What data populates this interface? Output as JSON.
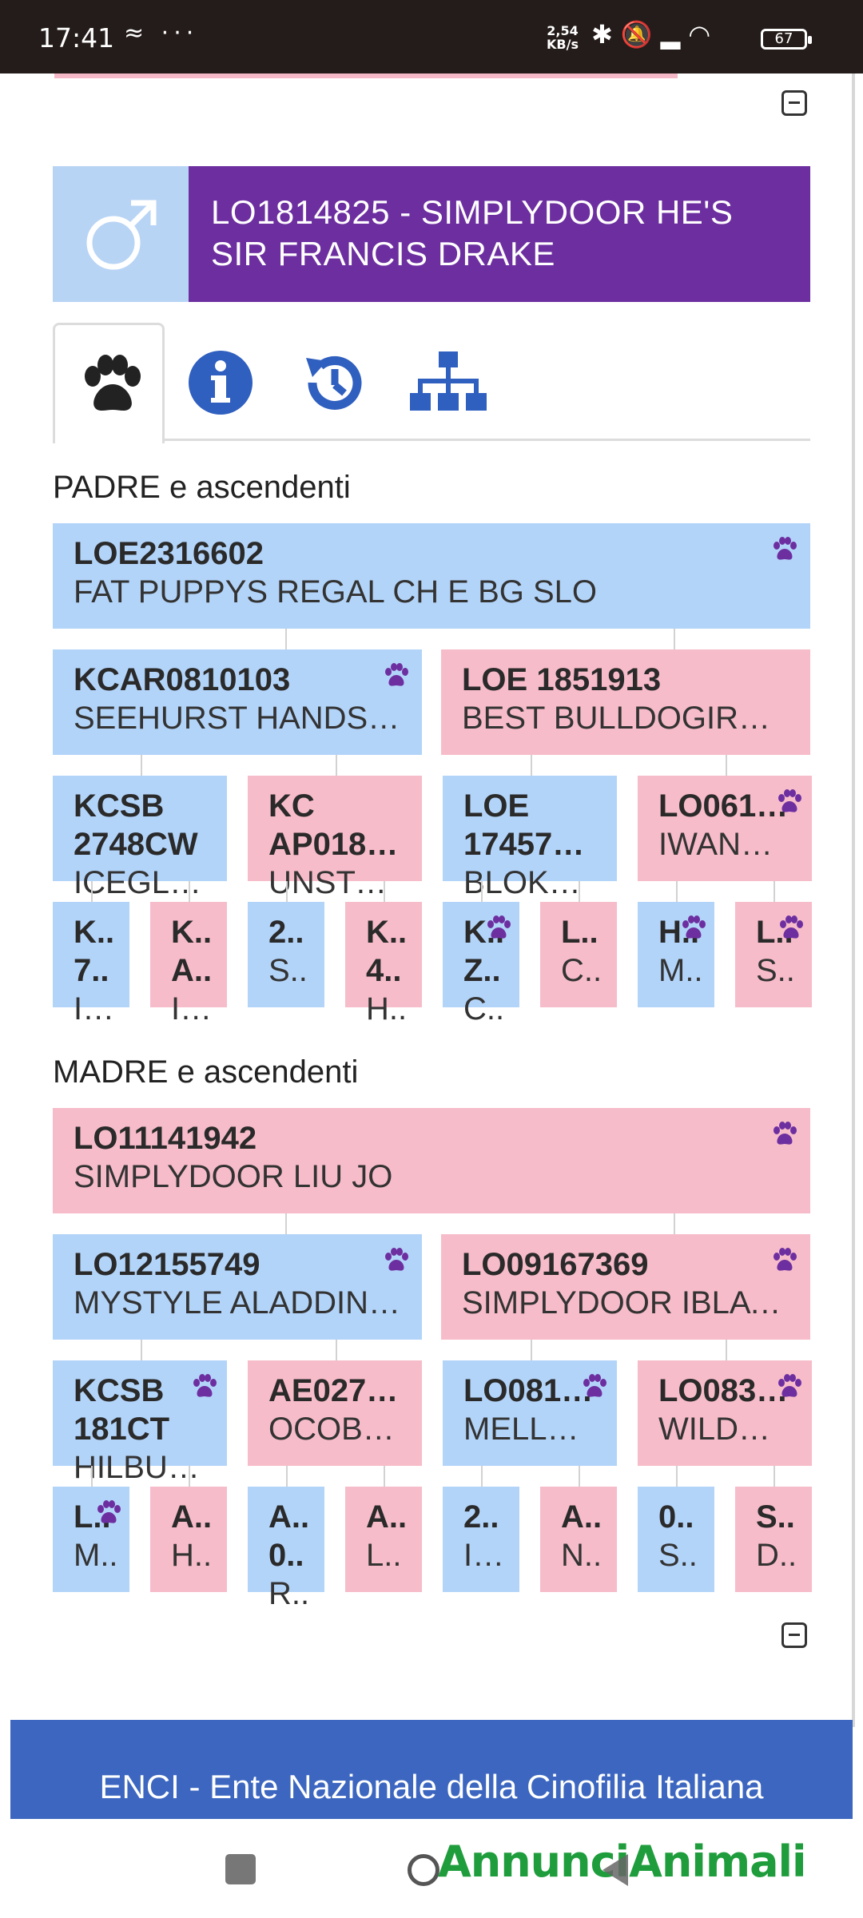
{
  "status_bar": {
    "time": "17:41",
    "left_icons": "≈ ···",
    "net_speed_value": "2,54",
    "net_speed_unit": "KB/s",
    "battery": "67"
  },
  "dog": {
    "sex_icon": "male-icon",
    "title": "LO1814825 - SIMPLYDOOR HE'S SIR FRANCIS DRAKE"
  },
  "tabs": [
    {
      "icon": "paw-icon",
      "active": true
    },
    {
      "icon": "info-icon",
      "active": false
    },
    {
      "icon": "history-icon",
      "active": false
    },
    {
      "icon": "pedigree-tree-icon",
      "active": false
    }
  ],
  "sire_section": {
    "title": "PADRE e ascendenti",
    "gen1": {
      "code": "LOE2316602",
      "name": "FAT PUPPYS REGAL CH E BG SLO",
      "paw": true
    },
    "gen2": [
      {
        "code": "KCAR0810103",
        "name": "SEEHURST HANDS …",
        "paw": true
      },
      {
        "code": "LOE 1851913",
        "name": "BEST BULLDOGIRO…",
        "paw": false
      }
    ],
    "gen3": [
      {
        "code1": "KCSB",
        "code2": "2748CW",
        "name": "ICEGLI…",
        "paw": false
      },
      {
        "code1": "KC",
        "code2": "AP018…",
        "name": "UNSTO…",
        "paw": false
      },
      {
        "code1": "LOE",
        "code2": "17457…",
        "name": "BLOKH…",
        "paw": false
      },
      {
        "code1": "LO061…",
        "code2": "",
        "name": "IWANN…",
        "paw": true
      }
    ],
    "gen4": [
      {
        "code1": "K..",
        "code2": "7..",
        "name": "I…",
        "paw": false
      },
      {
        "code1": "K..",
        "code2": "A..",
        "name": "I…",
        "paw": false
      },
      {
        "code1": "2..",
        "code2": "S..",
        "name": "",
        "paw": false
      },
      {
        "code1": "K..",
        "code2": "4..",
        "name": "H..",
        "paw": false
      },
      {
        "code1": "K..",
        "code2": "Z..",
        "name": "C..",
        "paw": true
      },
      {
        "code1": "L..",
        "code2": "C..",
        "name": "",
        "paw": false
      },
      {
        "code1": "H..",
        "code2": "M..",
        "name": "",
        "paw": true
      },
      {
        "code1": "L..",
        "code2": "S..",
        "name": "",
        "paw": true
      }
    ]
  },
  "dam_section": {
    "title": "MADRE e ascendenti",
    "gen1": {
      "code": "LO11141942",
      "name": "SIMPLYDOOR LIU JO",
      "paw": true
    },
    "gen2": [
      {
        "code": "LO12155749",
        "name": "MYSTYLE ALADDIN …",
        "paw": true
      },
      {
        "code": "LO09167369",
        "name": "SIMPLYDOOR IBLA …",
        "paw": true
      }
    ],
    "gen3": [
      {
        "code1": "KCSB",
        "code2": "181CT",
        "name": "HILBU…",
        "paw": true
      },
      {
        "code1": "AE027…",
        "code2": "",
        "name": "OCOB…",
        "paw": false
      },
      {
        "code1": "LO081…",
        "code2": "",
        "name": "MELLO…",
        "paw": true
      },
      {
        "code1": "LO083…",
        "code2": "",
        "name": "WILDC…",
        "paw": true
      }
    ],
    "gen4": [
      {
        "code1": "L..",
        "code2": "M..",
        "name": "",
        "paw": true
      },
      {
        "code1": "A..",
        "code2": "H..",
        "name": "",
        "paw": false
      },
      {
        "code1": "A..",
        "code2": "0..",
        "name": "R..",
        "paw": false
      },
      {
        "code1": "A..",
        "code2": "L..",
        "name": "",
        "paw": false
      },
      {
        "code1": "2..",
        "code2": "I…",
        "name": "",
        "paw": false
      },
      {
        "code1": "A..",
        "code2": "N..",
        "name": "",
        "paw": false
      },
      {
        "code1": "0..",
        "code2": "S..",
        "name": "",
        "paw": false
      },
      {
        "code1": "S..",
        "code2": "D..",
        "name": "",
        "paw": false
      }
    ]
  },
  "footer": {
    "text": "ENCI - Ente Nazionale della Cinofilia Italiana"
  },
  "nav": {
    "brand": "AnnunciAnimali"
  },
  "colors": {
    "male": "#b3d4f9",
    "female": "#f7bcca",
    "title_bg": "#6d2fa0",
    "icon_blue": "#2f5fbf",
    "paw_purple": "#6d2fa0",
    "footer_bg": "#3c66bf"
  }
}
